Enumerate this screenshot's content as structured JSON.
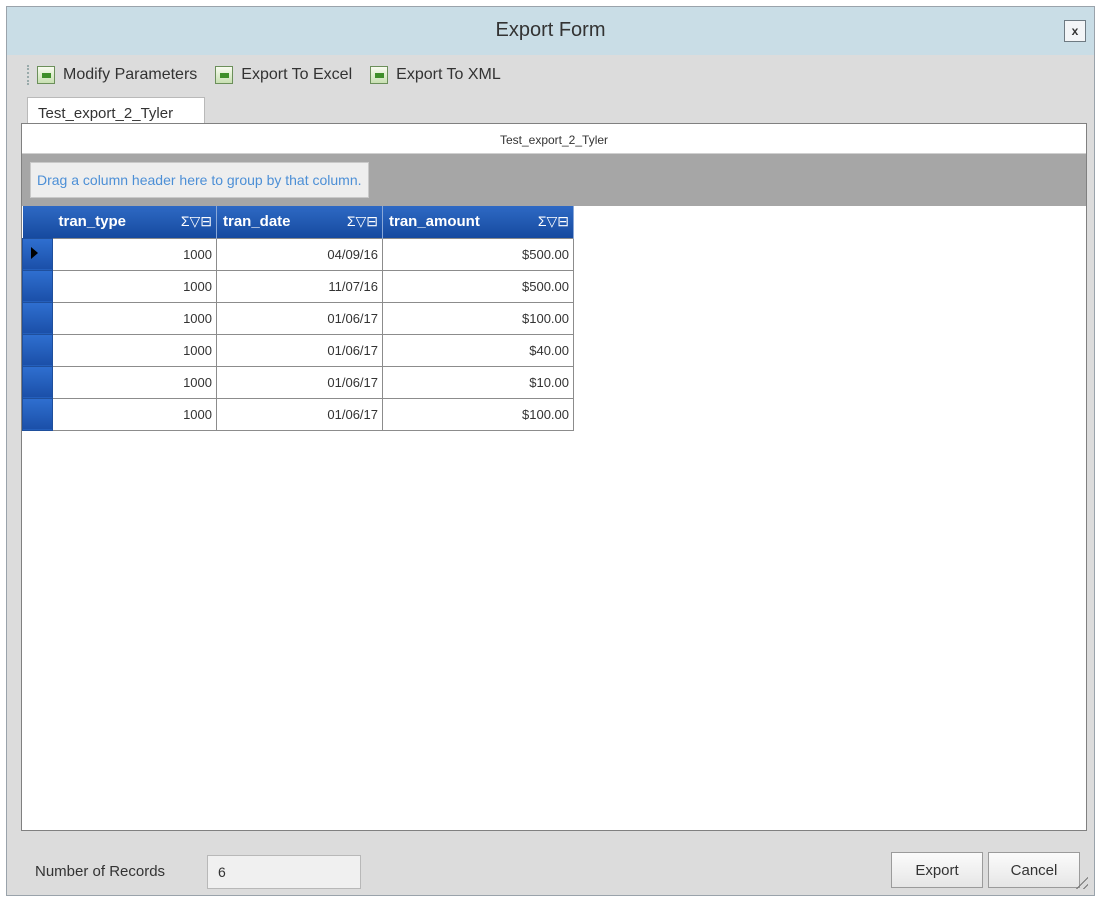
{
  "window": {
    "title": "Export Form",
    "close_label": "x"
  },
  "toolbar": {
    "modify_label": "Modify Parameters",
    "excel_label": "Export To Excel",
    "xml_label": "Export To XML"
  },
  "tab": {
    "label": "Test_export_2_Tyler"
  },
  "grid": {
    "caption": "Test_export_2_Tyler",
    "group_hint": "Drag a column header here to group by that column.",
    "column_icons": "Σ▽⊟",
    "columns": [
      "tran_type",
      "tran_date",
      "tran_amount"
    ],
    "rows": [
      [
        "1000",
        "04/09/16",
        "$500.00"
      ],
      [
        "1000",
        "11/07/16",
        "$500.00"
      ],
      [
        "1000",
        "01/06/17",
        "$100.00"
      ],
      [
        "1000",
        "01/06/17",
        "$40.00"
      ],
      [
        "1000",
        "01/06/17",
        "$10.00"
      ],
      [
        "1000",
        "01/06/17",
        "$100.00"
      ]
    ]
  },
  "footer": {
    "records_label": "Number of Records",
    "records_value": "6",
    "export_label": "Export",
    "cancel_label": "Cancel"
  }
}
